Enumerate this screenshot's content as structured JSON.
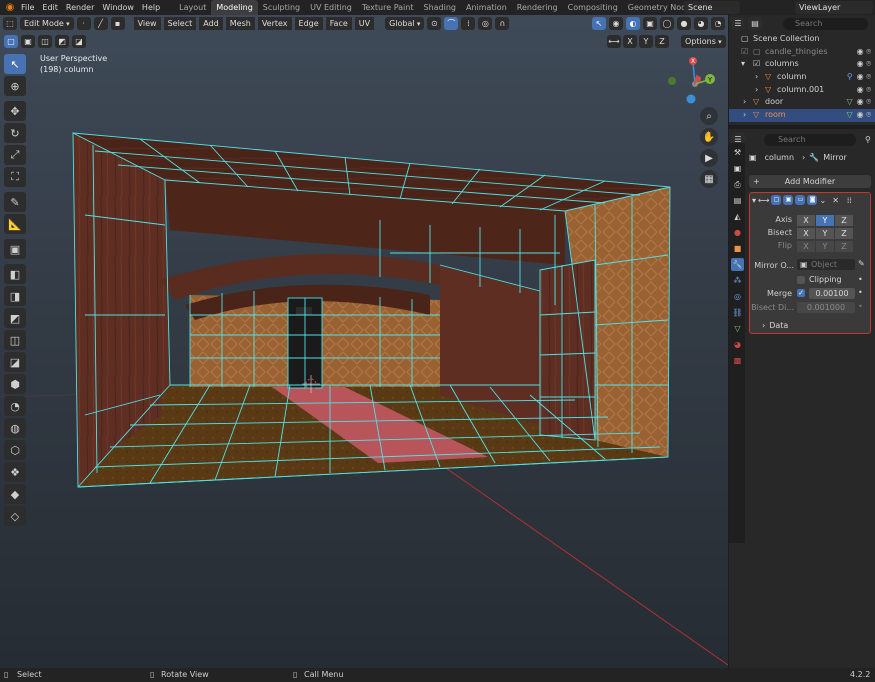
{
  "topbar": {
    "menus": [
      "File",
      "Edit",
      "Render",
      "Window",
      "Help"
    ],
    "workspaces": [
      "Layout",
      "Modeling",
      "Sculpting",
      "UV Editing",
      "Texture Paint",
      "Shading",
      "Animation",
      "Rendering",
      "Compositing",
      "Geometry Nodes",
      "Sc"
    ],
    "active_workspace": "Modeling",
    "scene": "Scene",
    "view_layer": "ViewLayer"
  },
  "viewport_header": {
    "mode": "Edit Mode",
    "menus": [
      "View",
      "Select",
      "Add",
      "Mesh",
      "Vertex",
      "Edge",
      "Face",
      "UV"
    ],
    "transform_orientation": "Global",
    "axis_x": "X",
    "axis_y": "Y",
    "axis_z": "Z",
    "options": "Options"
  },
  "viewport": {
    "perspective": "User Perspective",
    "object_info": "(198) column"
  },
  "outliner": {
    "search_placeholder": "Search",
    "rows": [
      {
        "name": "Scene Collection"
      },
      {
        "name": "candle_thingies"
      },
      {
        "name": "columns"
      },
      {
        "name": "column"
      },
      {
        "name": "column.001"
      },
      {
        "name": "door"
      },
      {
        "name": "room"
      }
    ]
  },
  "properties": {
    "search_placeholder": "Search",
    "breadcrumb_object": "column",
    "breadcrumb_modifier": "Mirror",
    "add_modifier": "Add Modifier",
    "axis_label": "Axis",
    "bisect_label": "Bisect",
    "flip_label": "Flip",
    "mirror_object_label": "Mirror O...",
    "object_placeholder": "Object",
    "clipping_label": "Clipping",
    "merge_label": "Merge",
    "merge_value": "0.00100",
    "bisect_dist_label": "Bisect Di...",
    "bisect_dist_value": "0.001000",
    "data_label": "Data",
    "x": "X",
    "y": "Y",
    "z": "Z"
  },
  "statusbar": {
    "select": "Select",
    "rotate": "Rotate View",
    "call_menu": "Call Menu",
    "version": "4.2.2"
  },
  "colors": {
    "accent": "#4772b3",
    "wire": "#4fe3e8",
    "selected_face": "#c85a66",
    "modifier_border": "#c0392b"
  }
}
